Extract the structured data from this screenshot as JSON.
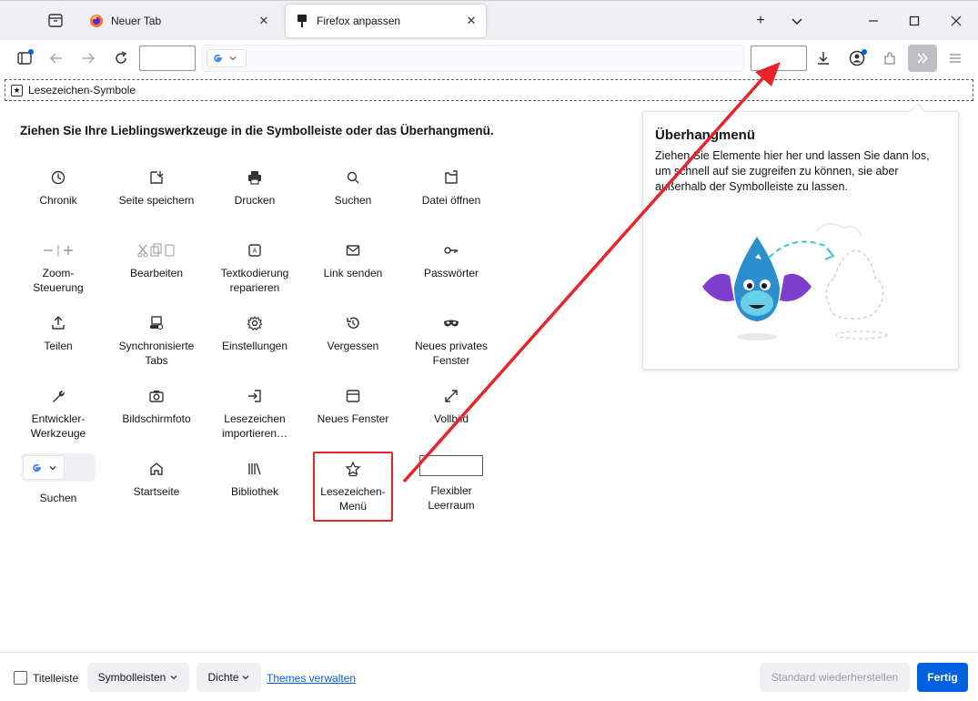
{
  "colors": {
    "accent": "#0061e0",
    "highlight": "#e8232a",
    "overflow_button": "#bebec3"
  },
  "tabs": [
    {
      "label": "Neuer Tab",
      "icon": "firefox-icon",
      "active": false
    },
    {
      "label": "Firefox anpassen",
      "icon": "paintbrush-icon",
      "active": true
    }
  ],
  "bookmarks_toolbar": {
    "label": "Lesezeichen-Symbole"
  },
  "palette": {
    "heading": "Ziehen Sie Ihre Lieblingswerkzeuge in die Symbolleiste oder das Überhangmenü.",
    "items": [
      {
        "label": "Chronik",
        "icon": "clock-icon"
      },
      {
        "label": "Seite speichern",
        "icon": "save-page-icon"
      },
      {
        "label": "Drucken",
        "icon": "printer-icon"
      },
      {
        "label": "Suchen",
        "icon": "search-icon"
      },
      {
        "label": "Datei öffnen",
        "icon": "open-file-icon"
      },
      {
        "label": "Zoom-\nSteuerung",
        "icon": "zoom-icon"
      },
      {
        "label": "Bearbeiten",
        "icon": "edit-icon"
      },
      {
        "label": "Textkodierung\nreparieren",
        "icon": "text-encoding-icon"
      },
      {
        "label": "Link senden",
        "icon": "mail-icon"
      },
      {
        "label": "Passwörter",
        "icon": "key-icon"
      },
      {
        "label": "Teilen",
        "icon": "share-icon"
      },
      {
        "label": "Synchronisierte\nTabs",
        "icon": "synced-tabs-icon"
      },
      {
        "label": "Einstellungen",
        "icon": "gear-icon"
      },
      {
        "label": "Vergessen",
        "icon": "forget-icon"
      },
      {
        "label": "Neues privates\nFenster",
        "icon": "private-mask-icon"
      },
      {
        "label": "Entwickler-\nWerkzeuge",
        "icon": "wrench-icon"
      },
      {
        "label": "Bildschirmfoto",
        "icon": "camera-icon"
      },
      {
        "label": "Lesezeichen\nimportieren…",
        "icon": "import-icon"
      },
      {
        "label": "Neues Fenster",
        "icon": "window-icon"
      },
      {
        "label": "Vollbild",
        "icon": "fullscreen-icon"
      },
      {
        "label": "Suchen",
        "icon": "search-engine-icon"
      },
      {
        "label": "Startseite",
        "icon": "home-icon"
      },
      {
        "label": "Bibliothek",
        "icon": "library-icon"
      },
      {
        "label": "Lesezeichen-\nMenü",
        "icon": "bookmark-star-icon"
      },
      {
        "label": "Flexibler\nLeerraum",
        "icon": "flexible-space-icon"
      }
    ]
  },
  "overflow_panel": {
    "title": "Überhangmenü",
    "text": "Ziehen Sie Elemente hier her und lassen Sie dann los, um schnell auf sie zugreifen zu können, sie aber außerhalb der Symbolleiste zu lassen."
  },
  "bottom_bar": {
    "titlebar_label": "Titelleiste",
    "toolbars_label": "Symbolleisten",
    "density_label": "Dichte",
    "themes_link": "Themes verwalten",
    "restore_label": "Standard wiederherstellen",
    "done_label": "Fertig"
  }
}
